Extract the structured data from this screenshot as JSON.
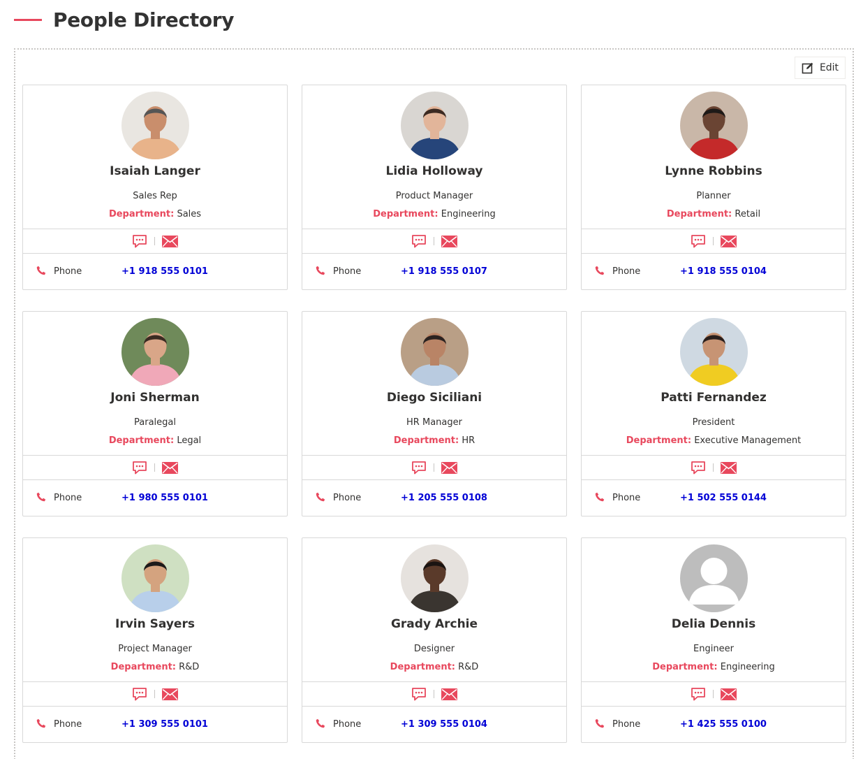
{
  "page": {
    "title": "People Directory"
  },
  "toolbar": {
    "edit_label": "Edit"
  },
  "card_labels": {
    "department": "Department:",
    "phone": "Phone"
  },
  "colors": {
    "accent": "#e8485d",
    "phone_link": "#0000d6",
    "border": "#d8d8d8"
  },
  "people": [
    {
      "name": "Isaiah Langer",
      "job_title": "Sales Rep",
      "department": "Sales",
      "phone": "+1 918 555 0101",
      "photo": "photo-man-smiling-beige"
    },
    {
      "name": "Lidia Holloway",
      "job_title": "Product Manager",
      "department": "Engineering",
      "phone": "+1 918 555 0107",
      "photo": "photo-woman-dark-hair-blue"
    },
    {
      "name": "Lynne Robbins",
      "job_title": "Planner",
      "department": "Retail",
      "phone": "+1 918 555 0104",
      "photo": "photo-woman-red-top"
    },
    {
      "name": "Joni Sherman",
      "job_title": "Paralegal",
      "department": "Legal",
      "phone": "+1 980 555 0101",
      "photo": "photo-woman-pink-outdoors"
    },
    {
      "name": "Diego Siciliani",
      "job_title": "HR Manager",
      "department": "HR",
      "phone": "+1 205 555 0108",
      "photo": "photo-man-blue-shirt"
    },
    {
      "name": "Patti Fernandez",
      "job_title": "President",
      "department": "Executive Management",
      "phone": "+1 502 555 0144",
      "photo": "photo-woman-yellow-jacket"
    },
    {
      "name": "Irvin Sayers",
      "job_title": "Project Manager",
      "department": "R&D",
      "phone": "+1 309 555 0101",
      "photo": "photo-man-tie"
    },
    {
      "name": "Grady Archie",
      "job_title": "Designer",
      "department": "R&D",
      "phone": "+1 309 555 0104",
      "photo": "photo-man-smiling-dark"
    },
    {
      "name": "Delia Dennis",
      "job_title": "Engineer",
      "department": "Engineering",
      "phone": "+1 425 555 0100",
      "photo": "default-avatar-icon"
    }
  ]
}
